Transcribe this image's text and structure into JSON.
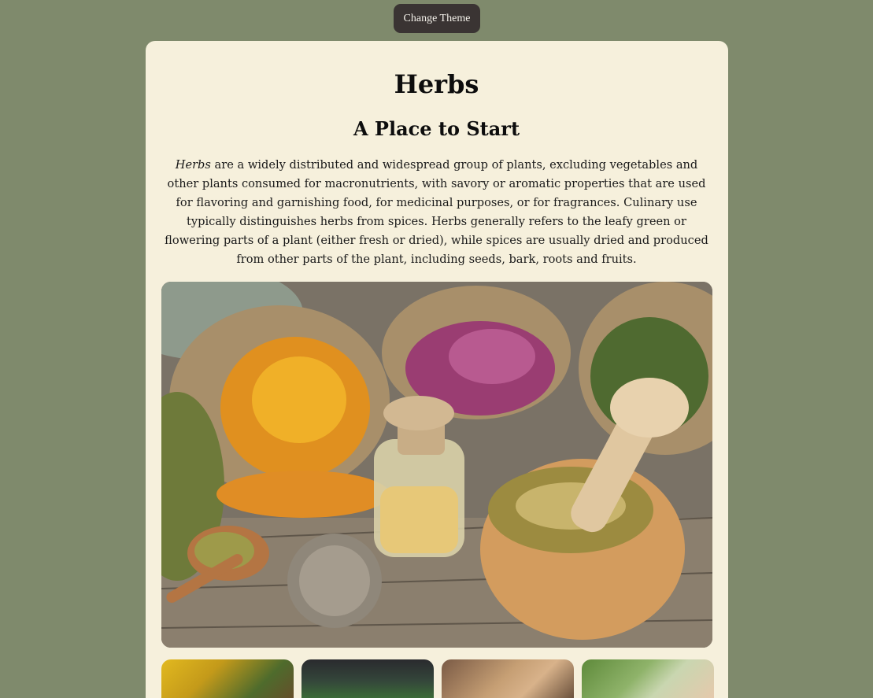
{
  "header": {
    "theme_button_label": "Change Theme"
  },
  "main": {
    "title": "Herbs",
    "subtitle": "A Place to Start",
    "intro_lead": "Herbs",
    "intro_rest": " are a widely distributed and widespread group of plants, excluding vegetables and other plants consumed for macronutrients, with savory or aromatic properties that are used for flavoring and garnishing food, for medicinal purposes, or for fragrances. Culinary use typically distinguishes herbs from spices. Herbs generally refers to the leafy green or flowering parts of a plant (either fresh or dried), while spices are usually dried and produced from other parts of the plant, including seeds, bark, roots and fruits."
  },
  "colors": {
    "background": "#7f8a6c",
    "card": "#f6f0dc",
    "button": "#3a3433",
    "text": "#0d0d0d"
  }
}
